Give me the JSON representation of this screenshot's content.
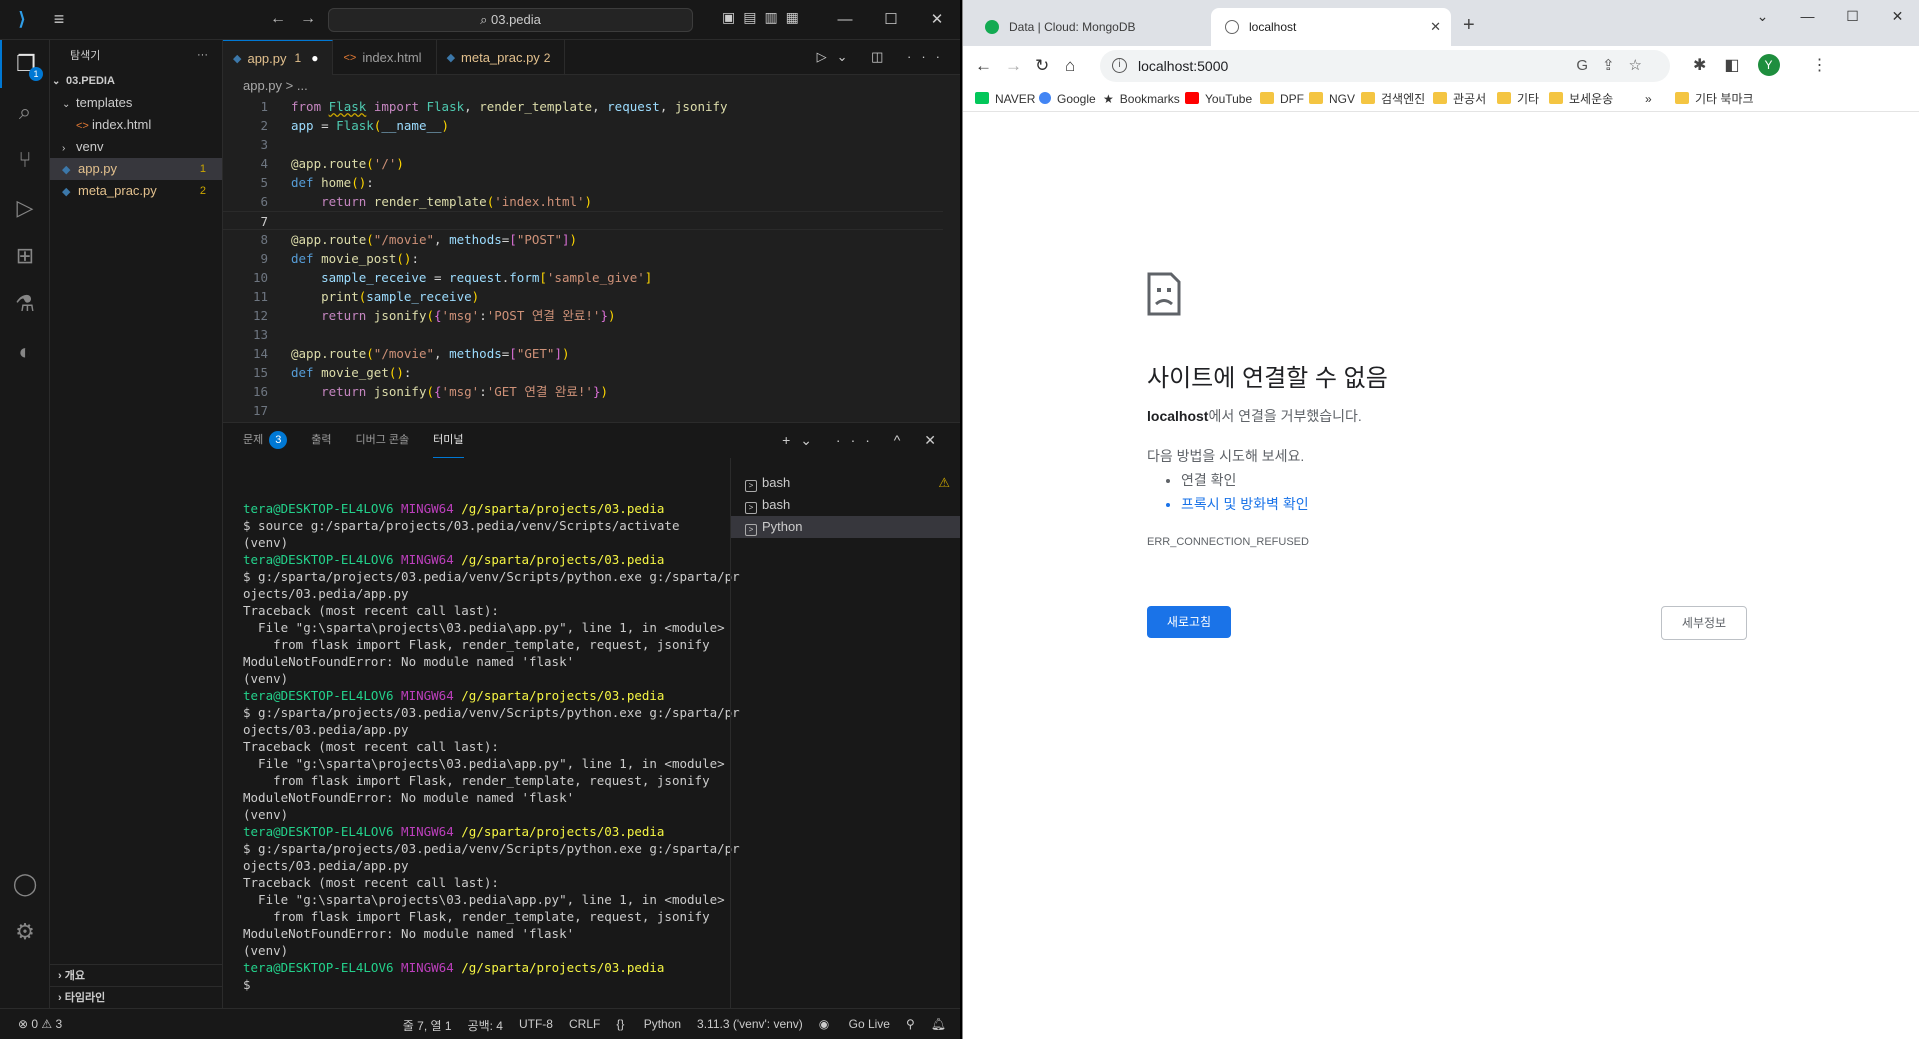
{
  "vscode": {
    "search_text": "03.pedia",
    "sidebar": {
      "title": "탐색기",
      "root": "03.PEDIA",
      "items": [
        {
          "label": "templates",
          "count": ""
        },
        {
          "label": "index.html",
          "count": ""
        },
        {
          "label": "venv",
          "count": ""
        },
        {
          "label": "app.py",
          "count": "1"
        },
        {
          "label": "meta_prac.py",
          "count": "2"
        }
      ],
      "outline": "개요",
      "timeline": "타임라인"
    },
    "tabs": [
      {
        "label": "app.py",
        "count": "1"
      },
      {
        "label": "index.html",
        "count": ""
      },
      {
        "label": "meta_prac.py",
        "count": "2"
      }
    ],
    "breadcrumb": "app.py > ...",
    "code_line_numbers": [
      "1",
      "2",
      "3",
      "4",
      "5",
      "6",
      "7",
      "8",
      "9",
      "10",
      "11",
      "12",
      "13",
      "14",
      "15",
      "16",
      "17"
    ],
    "panel": {
      "tabs": [
        "문제",
        "출력",
        "디버그 콘솔",
        "터미널"
      ],
      "problems_count": "3",
      "terminals": [
        "bash",
        "bash",
        "Python"
      ]
    },
    "terminal_lines": [
      "",
      "tera@DESKTOP-EL4LOV6 MINGW64 /g/sparta/projects/03.pedia",
      "$ source g:/sparta/projects/03.pedia/venv/Scripts/activate",
      "(venv)",
      "tera@DESKTOP-EL4LOV6 MINGW64 /g/sparta/projects/03.pedia",
      "$ g:/sparta/projects/03.pedia/venv/Scripts/python.exe g:/sparta/pr",
      "ojects/03.pedia/app.py",
      "Traceback (most recent call last):",
      "  File \"g:\\sparta\\projects\\03.pedia\\app.py\", line 1, in <module>",
      "    from flask import Flask, render_template, request, jsonify",
      "ModuleNotFoundError: No module named 'flask'",
      "(venv)",
      "tera@DESKTOP-EL4LOV6 MINGW64 /g/sparta/projects/03.pedia",
      "$ g:/sparta/projects/03.pedia/venv/Scripts/python.exe g:/sparta/pr",
      "ojects/03.pedia/app.py",
      "Traceback (most recent call last):",
      "  File \"g:\\sparta\\projects\\03.pedia\\app.py\", line 1, in <module>",
      "    from flask import Flask, render_template, request, jsonify",
      "ModuleNotFoundError: No module named 'flask'",
      "(venv)",
      "tera@DESKTOP-EL4LOV6 MINGW64 /g/sparta/projects/03.pedia",
      "$ g:/sparta/projects/03.pedia/venv/Scripts/python.exe g:/sparta/pr",
      "ojects/03.pedia/app.py",
      "Traceback (most recent call last):",
      "  File \"g:\\sparta\\projects\\03.pedia\\app.py\", line 1, in <module>",
      "    from flask import Flask, render_template, request, jsonify",
      "ModuleNotFoundError: No module named 'flask'",
      "(venv)",
      "tera@DESKTOP-EL4LOV6 MINGW64 /g/sparta/projects/03.pedia",
      "$"
    ],
    "status": {
      "errors": "0",
      "warnings": "3",
      "position": "줄 7, 열 1",
      "spaces": "공백: 4",
      "encoding": "UTF-8",
      "eol": "CRLF",
      "language": "Python",
      "interpreter": "3.11.3 ('venv': venv)",
      "golive": "Go Live"
    }
  },
  "chrome": {
    "tabs": [
      {
        "label": "Data | Cloud: MongoDB Cloud"
      },
      {
        "label": "localhost"
      }
    ],
    "url": "localhost:5000",
    "profile_initial": "Y",
    "bookmarks": [
      "NAVER",
      "Google",
      "Bookmarks",
      "YouTube",
      "DPF",
      "NGV",
      "검색엔진",
      "관공서",
      "기타",
      "보세운송",
      "기타 북마크"
    ],
    "error": {
      "title": "사이트에 연결할 수 없음",
      "host": "localhost",
      "desc_suffix": "에서 연결을 거부했습니다.",
      "try_text": "다음 방법을 시도해 보세요.",
      "suggestions": [
        "연결 확인",
        "프록시 및 방화벽 확인"
      ],
      "code": "ERR_CONNECTION_REFUSED",
      "reload_label": "새로고침",
      "details_label": "세부정보"
    }
  }
}
